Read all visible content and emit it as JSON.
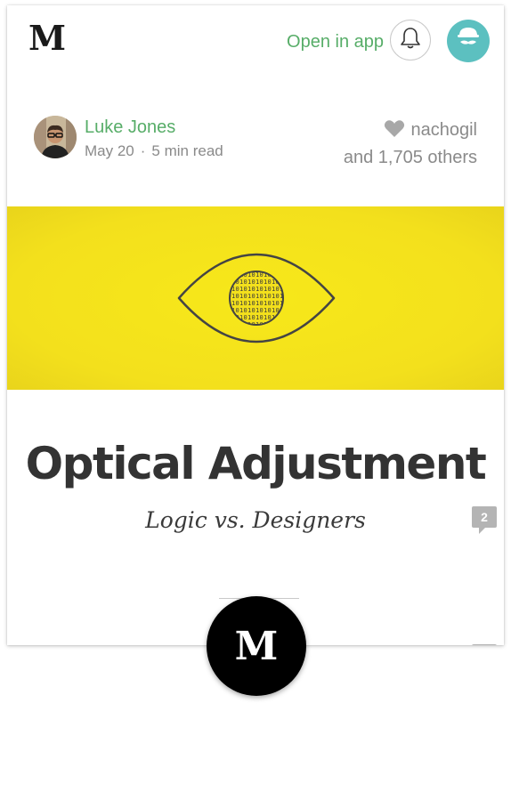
{
  "header": {
    "logo": "M",
    "open_in_app": "Open in app"
  },
  "author": {
    "name": "Luke Jones",
    "date": "May 20",
    "separator": "·",
    "read_time": "5 min read"
  },
  "likes": {
    "user": "nachogil",
    "others": "and 1,705 others"
  },
  "article": {
    "title": "Optical Adjustment",
    "subtitle": "Logic vs. Designers",
    "comment_count": "2"
  },
  "fab": {
    "label": "M"
  },
  "colors": {
    "accent_green": "#57ad68",
    "hero_yellow": "#f3e01c",
    "avatar_teal": "#5cc0c0",
    "meta_gray": "#8a8a8a"
  },
  "icons": {
    "notifications": "bell-icon",
    "user": "user-avatar-icon",
    "like": "heart-icon",
    "comment": "comment-bubble-icon",
    "hero": "eye-illustration"
  }
}
